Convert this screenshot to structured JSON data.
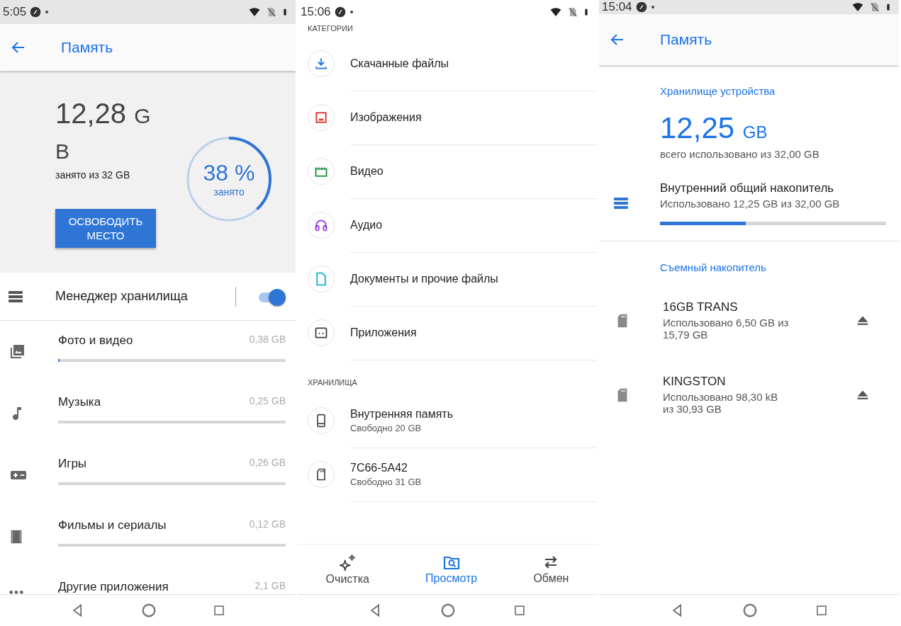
{
  "storage_settings": {
    "status_bar": {
      "time": "5:05"
    },
    "app_bar": {
      "title": "Память"
    },
    "summary": {
      "used": "12,28",
      "unit": "GB",
      "caption": "занято из 32 GB",
      "percent": "38 %",
      "percent_caption": "занято",
      "level": 0.38
    },
    "free_button": "ОСВОБОДИТЬ МЕСТО",
    "storage_manager": {
      "label": "Менеджер хранилища",
      "on": true
    },
    "categories": [
      {
        "kind": "photos",
        "label": "Фото и видео",
        "size": "0,38 GB",
        "level": 0.006
      },
      {
        "kind": "music",
        "label": "Музыка",
        "size": "0,25 GB"
      },
      {
        "kind": "games",
        "label": "Игры",
        "size": "0,26 GB"
      },
      {
        "kind": "movies",
        "label": "Фильмы и сериалы",
        "size": "0,12 GB"
      },
      {
        "kind": "apps",
        "label": "Другие приложения",
        "size": "2,1 GB"
      }
    ]
  },
  "files_browse": {
    "status_bar": {
      "time": "15:06"
    },
    "categories_header": "КАТЕГОРИИ",
    "categories": [
      {
        "kind": "downloads",
        "label": "Скачанные файлы",
        "color": "#1a73e8"
      },
      {
        "kind": "images",
        "label": "Изображения",
        "color": "#d93025"
      },
      {
        "kind": "video",
        "label": "Видео",
        "color": "#1e8e3e"
      },
      {
        "kind": "audio",
        "label": "Аудио",
        "color": "#9334e6"
      },
      {
        "kind": "documents",
        "label": "Документы и прочие файлы",
        "color": "#12b5cb"
      },
      {
        "kind": "apps",
        "label": "Приложения",
        "color": "#3c4043"
      }
    ],
    "storage_header": "ХРАНИЛИЩА",
    "storages": [
      {
        "kind": "phone",
        "name": "Внутренняя память",
        "free": "Свободно 20 GB"
      },
      {
        "kind": "sd",
        "name": "7C66-5A42",
        "free": "Свободно 31 GB"
      }
    ],
    "tabs": [
      {
        "kind": "clean",
        "label": "Очистка",
        "selected": false
      },
      {
        "kind": "browse",
        "label": "Просмотр",
        "selected": true
      },
      {
        "kind": "share",
        "label": "Обмен",
        "selected": false
      }
    ]
  },
  "storage_overview": {
    "status_bar": {
      "time": "15:04"
    },
    "app_bar": {
      "title": "Память"
    },
    "device_header": "Хранилище устройства",
    "used": "12,25",
    "unit": "GB",
    "caption": "всего использовано из 32,00 GB",
    "internal": {
      "name": "Внутренний общий накопитель",
      "detail": "Использовано 12,25 GB из 32,00 GB",
      "level": 0.38
    },
    "removable_header": "Съемный накопитель",
    "removable": [
      {
        "name": "16GB TRANS",
        "detail": "Использовано 6,50 GB из 15,79 GB"
      },
      {
        "name": "KINGSTON",
        "detail": "Использовано 98,30 kB из 30,93 GB"
      }
    ]
  }
}
